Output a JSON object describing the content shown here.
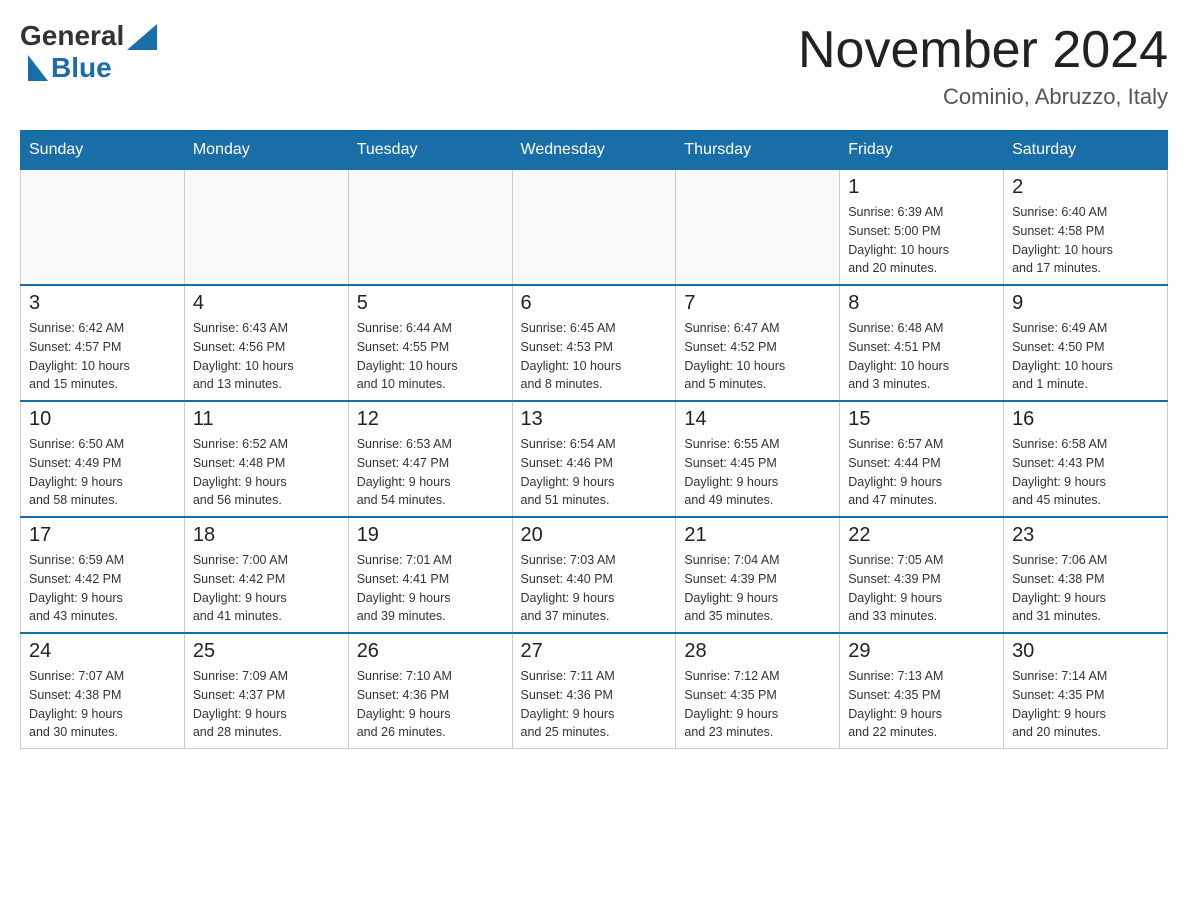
{
  "header": {
    "logo_general": "General",
    "logo_blue": "Blue",
    "month_year": "November 2024",
    "location": "Cominio, Abruzzo, Italy"
  },
  "weekdays": [
    "Sunday",
    "Monday",
    "Tuesday",
    "Wednesday",
    "Thursday",
    "Friday",
    "Saturday"
  ],
  "weeks": [
    {
      "days": [
        {
          "number": "",
          "info": ""
        },
        {
          "number": "",
          "info": ""
        },
        {
          "number": "",
          "info": ""
        },
        {
          "number": "",
          "info": ""
        },
        {
          "number": "",
          "info": ""
        },
        {
          "number": "1",
          "info": "Sunrise: 6:39 AM\nSunset: 5:00 PM\nDaylight: 10 hours\nand 20 minutes."
        },
        {
          "number": "2",
          "info": "Sunrise: 6:40 AM\nSunset: 4:58 PM\nDaylight: 10 hours\nand 17 minutes."
        }
      ]
    },
    {
      "days": [
        {
          "number": "3",
          "info": "Sunrise: 6:42 AM\nSunset: 4:57 PM\nDaylight: 10 hours\nand 15 minutes."
        },
        {
          "number": "4",
          "info": "Sunrise: 6:43 AM\nSunset: 4:56 PM\nDaylight: 10 hours\nand 13 minutes."
        },
        {
          "number": "5",
          "info": "Sunrise: 6:44 AM\nSunset: 4:55 PM\nDaylight: 10 hours\nand 10 minutes."
        },
        {
          "number": "6",
          "info": "Sunrise: 6:45 AM\nSunset: 4:53 PM\nDaylight: 10 hours\nand 8 minutes."
        },
        {
          "number": "7",
          "info": "Sunrise: 6:47 AM\nSunset: 4:52 PM\nDaylight: 10 hours\nand 5 minutes."
        },
        {
          "number": "8",
          "info": "Sunrise: 6:48 AM\nSunset: 4:51 PM\nDaylight: 10 hours\nand 3 minutes."
        },
        {
          "number": "9",
          "info": "Sunrise: 6:49 AM\nSunset: 4:50 PM\nDaylight: 10 hours\nand 1 minute."
        }
      ]
    },
    {
      "days": [
        {
          "number": "10",
          "info": "Sunrise: 6:50 AM\nSunset: 4:49 PM\nDaylight: 9 hours\nand 58 minutes."
        },
        {
          "number": "11",
          "info": "Sunrise: 6:52 AM\nSunset: 4:48 PM\nDaylight: 9 hours\nand 56 minutes."
        },
        {
          "number": "12",
          "info": "Sunrise: 6:53 AM\nSunset: 4:47 PM\nDaylight: 9 hours\nand 54 minutes."
        },
        {
          "number": "13",
          "info": "Sunrise: 6:54 AM\nSunset: 4:46 PM\nDaylight: 9 hours\nand 51 minutes."
        },
        {
          "number": "14",
          "info": "Sunrise: 6:55 AM\nSunset: 4:45 PM\nDaylight: 9 hours\nand 49 minutes."
        },
        {
          "number": "15",
          "info": "Sunrise: 6:57 AM\nSunset: 4:44 PM\nDaylight: 9 hours\nand 47 minutes."
        },
        {
          "number": "16",
          "info": "Sunrise: 6:58 AM\nSunset: 4:43 PM\nDaylight: 9 hours\nand 45 minutes."
        }
      ]
    },
    {
      "days": [
        {
          "number": "17",
          "info": "Sunrise: 6:59 AM\nSunset: 4:42 PM\nDaylight: 9 hours\nand 43 minutes."
        },
        {
          "number": "18",
          "info": "Sunrise: 7:00 AM\nSunset: 4:42 PM\nDaylight: 9 hours\nand 41 minutes."
        },
        {
          "number": "19",
          "info": "Sunrise: 7:01 AM\nSunset: 4:41 PM\nDaylight: 9 hours\nand 39 minutes."
        },
        {
          "number": "20",
          "info": "Sunrise: 7:03 AM\nSunset: 4:40 PM\nDaylight: 9 hours\nand 37 minutes."
        },
        {
          "number": "21",
          "info": "Sunrise: 7:04 AM\nSunset: 4:39 PM\nDaylight: 9 hours\nand 35 minutes."
        },
        {
          "number": "22",
          "info": "Sunrise: 7:05 AM\nSunset: 4:39 PM\nDaylight: 9 hours\nand 33 minutes."
        },
        {
          "number": "23",
          "info": "Sunrise: 7:06 AM\nSunset: 4:38 PM\nDaylight: 9 hours\nand 31 minutes."
        }
      ]
    },
    {
      "days": [
        {
          "number": "24",
          "info": "Sunrise: 7:07 AM\nSunset: 4:38 PM\nDaylight: 9 hours\nand 30 minutes."
        },
        {
          "number": "25",
          "info": "Sunrise: 7:09 AM\nSunset: 4:37 PM\nDaylight: 9 hours\nand 28 minutes."
        },
        {
          "number": "26",
          "info": "Sunrise: 7:10 AM\nSunset: 4:36 PM\nDaylight: 9 hours\nand 26 minutes."
        },
        {
          "number": "27",
          "info": "Sunrise: 7:11 AM\nSunset: 4:36 PM\nDaylight: 9 hours\nand 25 minutes."
        },
        {
          "number": "28",
          "info": "Sunrise: 7:12 AM\nSunset: 4:35 PM\nDaylight: 9 hours\nand 23 minutes."
        },
        {
          "number": "29",
          "info": "Sunrise: 7:13 AM\nSunset: 4:35 PM\nDaylight: 9 hours\nand 22 minutes."
        },
        {
          "number": "30",
          "info": "Sunrise: 7:14 AM\nSunset: 4:35 PM\nDaylight: 9 hours\nand 20 minutes."
        }
      ]
    }
  ]
}
